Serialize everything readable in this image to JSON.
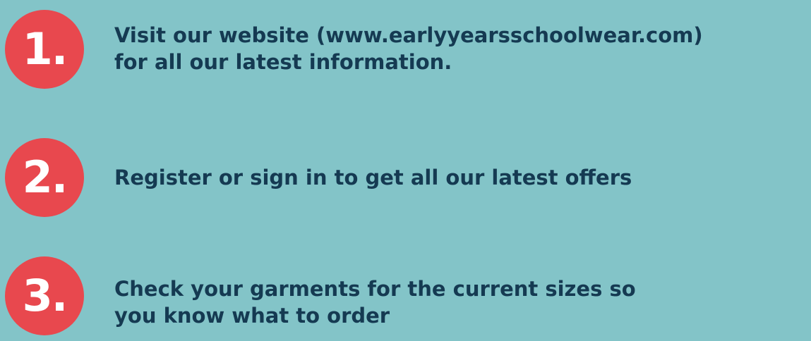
{
  "colors": {
    "background": "#83c4c8",
    "badge": "#e8484e",
    "badge_text": "#ffffff",
    "text": "#153a52"
  },
  "steps": [
    {
      "number": "1.",
      "lines": [
        "Visit our website (www.earlyyearsschoolwear.com)",
        "for all our latest information."
      ]
    },
    {
      "number": "2.",
      "lines": [
        "Register or sign in to get all our latest offers"
      ]
    },
    {
      "number": "3.",
      "lines": [
        "Check your garments for the current sizes so",
        "you know what to order"
      ]
    }
  ]
}
